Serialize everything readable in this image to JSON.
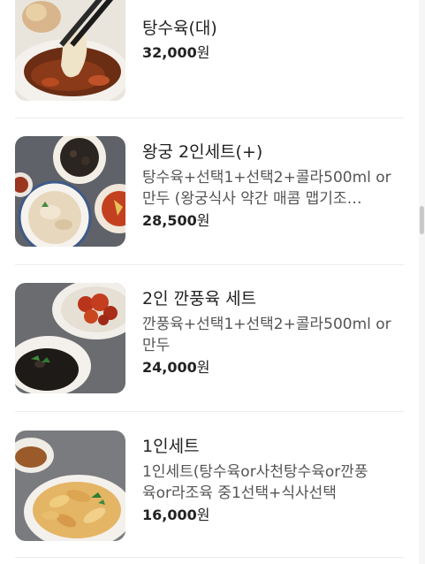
{
  "menu": {
    "items": [
      {
        "name": "탕수육(대)",
        "description": "",
        "price_number": "32,000",
        "price_unit": "원",
        "image_icon": "tangsuyuk-photo"
      },
      {
        "name": "왕궁 2인세트(+)",
        "description_line1": "탕수육+선택1+선택2+콜라500ml or",
        "description_line2": "만두 (왕궁식사 약간 매콤 맵기조…",
        "price_number": "28,500",
        "price_unit": "원",
        "image_icon": "set-meal-photo"
      },
      {
        "name": "2인 깐풍육 세트",
        "description_line1": "깐풍육+선택1+선택2+콜라500ml or",
        "description_line2": "만두",
        "price_number": "24,000",
        "price_unit": "원",
        "image_icon": "kkanpunggi-photo"
      },
      {
        "name": "1인세트",
        "description_line1": "1인세트(탕수육or사천탕수육or깐풍",
        "description_line2": "육or라조육 중1선택+식사선택",
        "price_number": "16,000",
        "price_unit": "원",
        "image_icon": "fried-pork-photo"
      }
    ]
  }
}
